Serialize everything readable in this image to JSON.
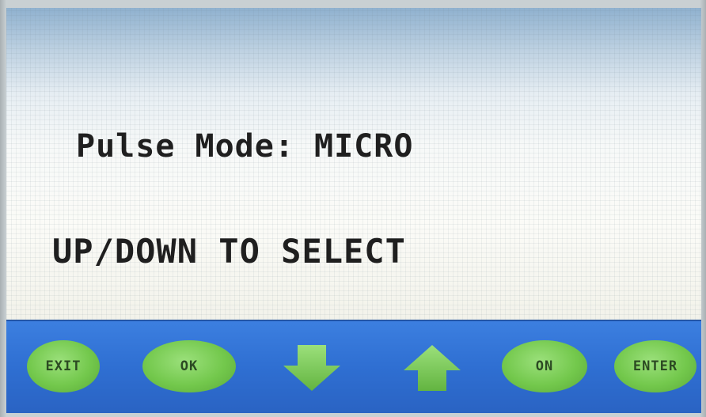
{
  "display": {
    "line1": "Pulse Mode: MICRO",
    "line2": "UP/DOWN TO SELECT"
  },
  "buttons": {
    "exit": "EXIT",
    "ok": "OK",
    "on": "ON",
    "enter": "ENTER"
  },
  "icons": {
    "down": "arrow-down-icon",
    "up": "arrow-up-icon"
  },
  "colors": {
    "button_bar": "#2f6fd2",
    "button_fill": "#73c84c",
    "text": "#1f1f1f"
  }
}
